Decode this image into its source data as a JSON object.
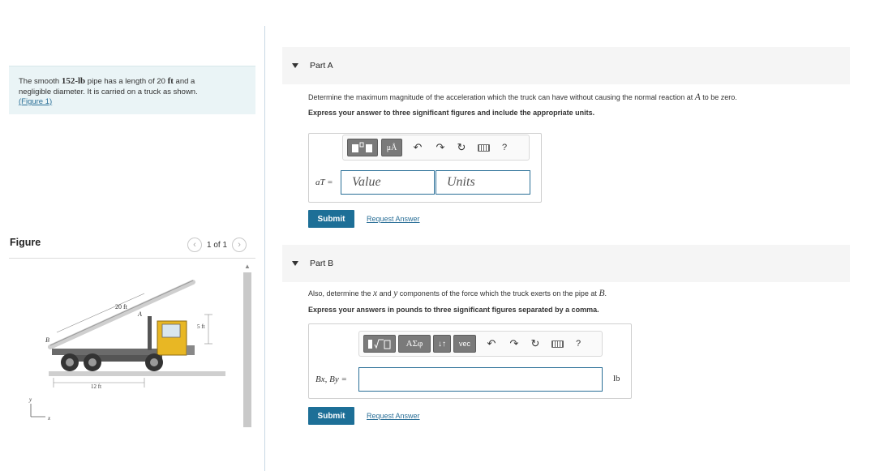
{
  "problem": {
    "text_before_weight": "The smooth ",
    "weight": "152-lb",
    "text_before_length": " pipe has a length of 20 ",
    "length_unit": "ft",
    "text_after_length": " and a",
    "line2": "negligible diameter. It is carried on a truck as shown.",
    "figure_link": "(Figure 1)"
  },
  "figure_panel": {
    "title": "Figure",
    "pager_text": "1 of 1",
    "prev_icon": "chevron-left-icon",
    "next_icon": "chevron-right-icon",
    "labels": {
      "length_20": "20 ft",
      "point_a": "A",
      "height_5": "5 ft",
      "point_b": "B",
      "length_12": "12 ft",
      "axis_y": "y",
      "axis_x": "x"
    }
  },
  "part_a": {
    "header": "Part A",
    "question_pre": "Determine the maximum magnitude of the acceleration which the truck can have without causing the normal reaction at ",
    "question_sym": "A",
    "question_post": " to be zero.",
    "instruction": "Express your answer to three significant figures and include the appropriate units.",
    "toolbar": {
      "units_button": "μÅ",
      "help": "?",
      "icons": [
        "template-icon",
        "units-icon",
        "undo-icon",
        "redo-icon",
        "reset-icon",
        "keyboard-icon",
        "help-icon"
      ]
    },
    "var_label": "aT =",
    "value_placeholder": "Value",
    "units_placeholder": "Units",
    "submit": "Submit",
    "request": "Request Answer"
  },
  "part_b": {
    "header": "Part B",
    "question_pre": "Also, determine the ",
    "question_x": "x",
    "question_mid": " and ",
    "question_y": "y",
    "question_post": " components of the force which the truck exerts on the pipe at ",
    "question_sym": "B",
    "question_end": ".",
    "instruction": "Express your answers in pounds to three significant figures separated by a comma.",
    "toolbar": {
      "greek_button": "ΑΣφ",
      "arrows_button": "↓↑",
      "vec_button": "vec",
      "help": "?",
      "icons": [
        "template-icon",
        "greek-icon",
        "arrows-icon",
        "vec-icon",
        "undo-icon",
        "redo-icon",
        "reset-icon",
        "keyboard-icon",
        "help-icon"
      ]
    },
    "var_label": "Bx, By =",
    "unit": "lb",
    "submit": "Submit",
    "request": "Request Answer"
  },
  "colors": {
    "accent": "#1d6f97",
    "truck_cab": "#e8b724",
    "problem_bg": "#eaf4f6"
  }
}
